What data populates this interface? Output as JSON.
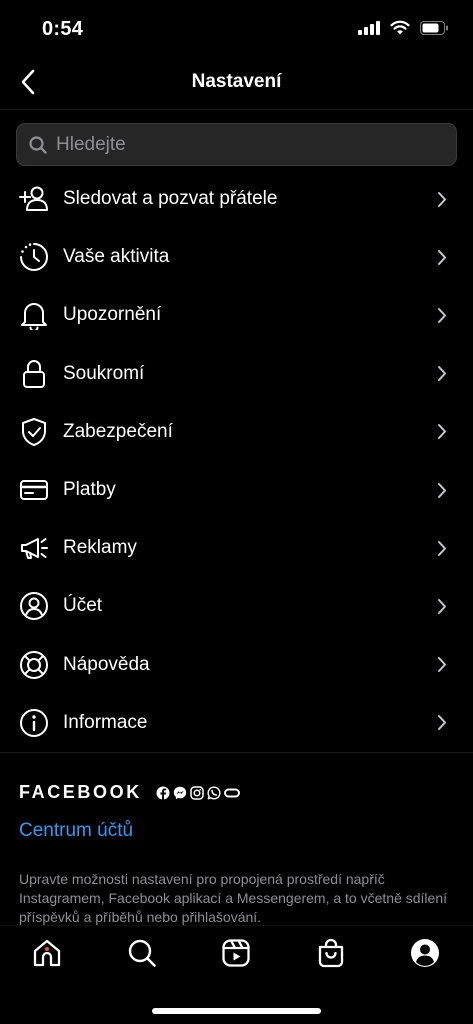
{
  "status_bar": {
    "time": "0:54"
  },
  "header": {
    "title": "Nastavení"
  },
  "search": {
    "placeholder": "Hledejte"
  },
  "menu": [
    {
      "label": "Sledovat a pozvat přátele",
      "icon": "add-person-icon"
    },
    {
      "label": "Vaše aktivita",
      "icon": "activity-clock-icon"
    },
    {
      "label": "Upozornění",
      "icon": "bell-icon"
    },
    {
      "label": "Soukromí",
      "icon": "lock-icon"
    },
    {
      "label": "Zabezpečení",
      "icon": "shield-check-icon"
    },
    {
      "label": "Platby",
      "icon": "credit-card-icon"
    },
    {
      "label": "Reklamy",
      "icon": "megaphone-icon"
    },
    {
      "label": "Účet",
      "icon": "account-circle-icon"
    },
    {
      "label": "Nápověda",
      "icon": "lifebuoy-icon"
    },
    {
      "label": "Informace",
      "icon": "info-icon"
    }
  ],
  "facebook": {
    "wordmark": "FACEBOOK",
    "link": "Centrum účtů",
    "description": "Upravte možnosti nastavení pro propojená prostředí napříč Instagramem, Facebook aplikací a Messengerem, a to včetně sdílení příspěvků a příběhů nebo přihlašování."
  },
  "tabs": [
    "home",
    "search",
    "reels",
    "shop",
    "profile"
  ],
  "colors": {
    "background": "#000000",
    "link": "#3897f0",
    "secondary_text": "#8e8e93",
    "notification_dot": "#ed4956"
  }
}
